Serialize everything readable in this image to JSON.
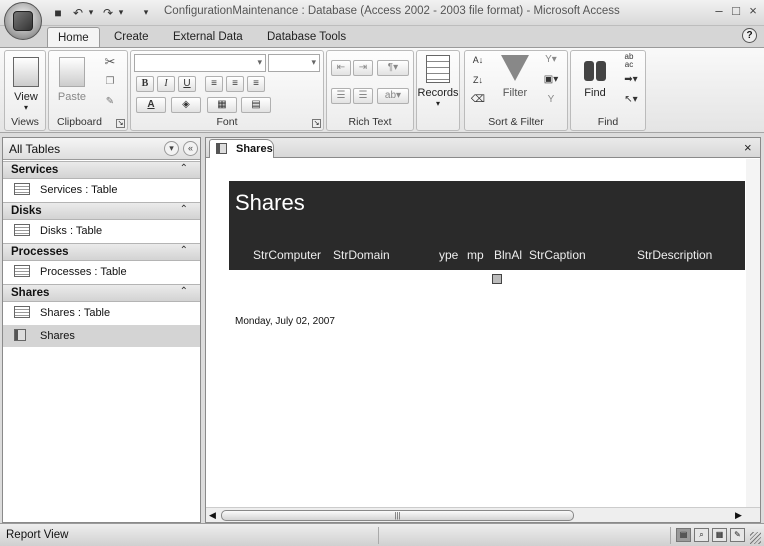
{
  "window": {
    "title": "ConfigurationMaintenance : Database (Access 2002 - 2003 file format) - Microsoft Access",
    "minimize_icon": "–",
    "maximize_icon": "□",
    "close_icon": "×"
  },
  "qat": {
    "save": "■",
    "undo": "↶",
    "redo": "↷",
    "customize": "▾"
  },
  "ribbon": {
    "tabs": [
      "Home",
      "Create",
      "External Data",
      "Database Tools"
    ],
    "help": "?",
    "groups": {
      "views": {
        "label": "Views",
        "view_button": "View"
      },
      "clipboard": {
        "label": "Clipboard",
        "paste_button": "Paste"
      },
      "font": {
        "label": "Font",
        "bold": "B",
        "italic": "I",
        "underline": "U",
        "font_color": "A"
      },
      "rich_text": {
        "label": "Rich Text"
      },
      "records": {
        "label": "Records",
        "button": "Records"
      },
      "sort_filter": {
        "label": "Sort & Filter",
        "filter_button": "Filter",
        "sort_asc": "A↓",
        "sort_desc": "Z↓"
      },
      "find": {
        "label": "Find",
        "find_button": "Find"
      }
    }
  },
  "nav_pane": {
    "title": "All Tables",
    "dropdown_icon": "▾",
    "collapse_icon": "«",
    "groups": [
      {
        "label": "Services",
        "items": [
          "Services : Table"
        ]
      },
      {
        "label": "Disks",
        "items": [
          "Disks : Table"
        ]
      },
      {
        "label": "Processes",
        "items": [
          "Processes : Table"
        ]
      },
      {
        "label": "Shares",
        "items": [
          "Shares : Table",
          "Shares"
        ]
      }
    ],
    "group_chevron": "⌃"
  },
  "document": {
    "tab_label": "Shares",
    "close_icon": "×",
    "report": {
      "title": "Shares",
      "columns": [
        "StrComputer",
        "StrDomain",
        "ype",
        "mp",
        "BlnAl",
        "StrCaption",
        "StrDescription"
      ],
      "date": "Monday, July 02, 2007"
    },
    "hscroll": {
      "left": "◀",
      "right": "▶",
      "thumb_grip": "|||"
    }
  },
  "status": {
    "text": "Report View"
  }
}
